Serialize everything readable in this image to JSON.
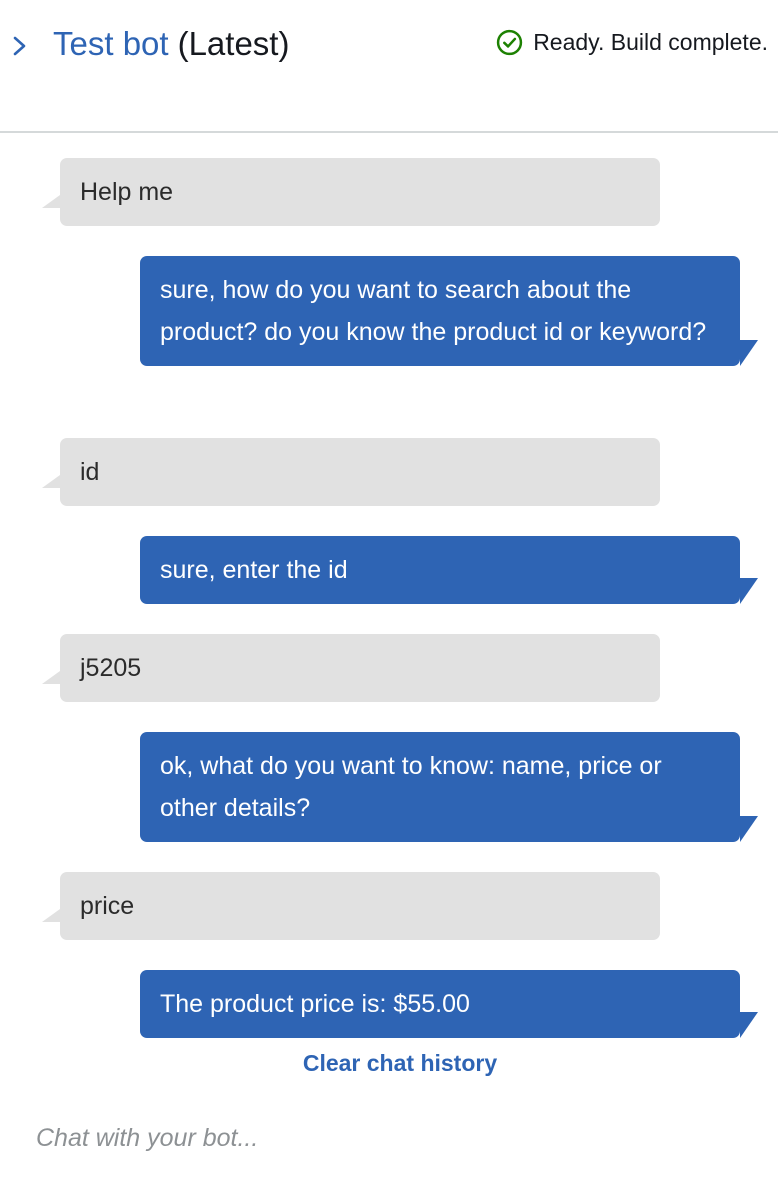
{
  "header": {
    "chevron_icon": "chevron-right-icon",
    "title": "Test bot",
    "version": "(Latest)",
    "status_icon": "check-circle-icon",
    "status_text": "Ready. Build complete."
  },
  "colors": {
    "accent": "#2e64b4",
    "user_bubble": "#e1e1e1",
    "status_ok": "#1d8102"
  },
  "messages": [
    {
      "role": "user",
      "text": "Help me"
    },
    {
      "role": "bot",
      "text": "sure, how do you want to search about the product? do you know the product id or keyword?"
    },
    {
      "role": "user",
      "text": "id"
    },
    {
      "role": "bot",
      "text": "sure, enter the id"
    },
    {
      "role": "user",
      "text": "j5205"
    },
    {
      "role": "bot",
      "text": "ok, what do you want to know: name, price or other details?"
    },
    {
      "role": "user",
      "text": "price"
    },
    {
      "role": "bot",
      "text": "The product price is: $55.00"
    }
  ],
  "clear_history_label": "Clear chat history",
  "input": {
    "placeholder": "Chat with your bot...",
    "value": ""
  }
}
